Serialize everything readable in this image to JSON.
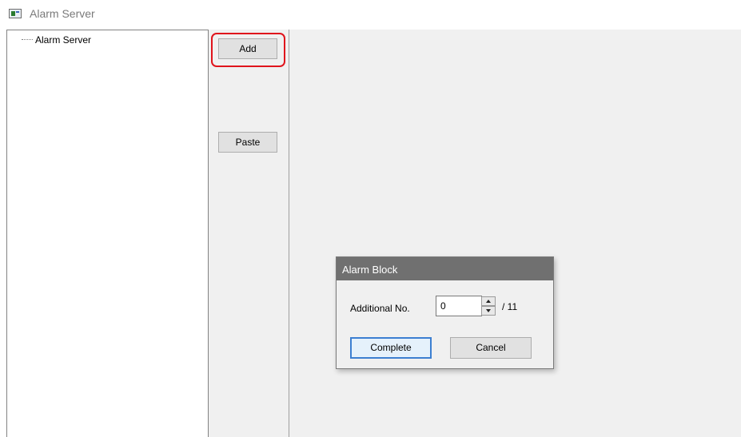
{
  "window": {
    "title": "Alarm Server",
    "icon": "app-window-icon"
  },
  "tree": {
    "items": [
      {
        "label": "Alarm Server"
      }
    ]
  },
  "buttons": {
    "add_label": "Add",
    "paste_label": "Paste",
    "highlight_color": "#e0141c"
  },
  "dialog": {
    "title": "Alarm Block",
    "field_label": "Additional No.",
    "field_value": "0",
    "field_max": "/ 11",
    "complete_label": "Complete",
    "cancel_label": "Cancel",
    "titlebar_color": "#707070"
  }
}
